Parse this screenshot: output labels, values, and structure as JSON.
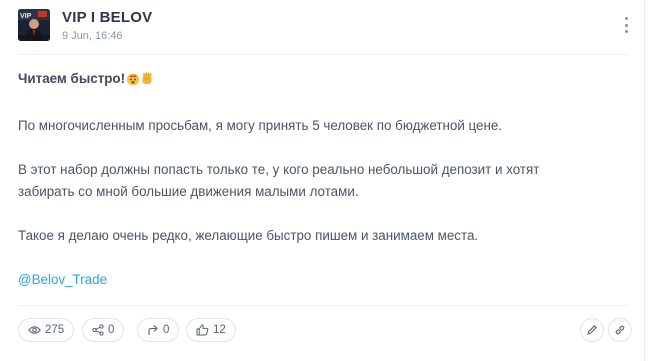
{
  "post": {
    "channel_name": "VIP I BELOV",
    "date": "9 Jun, 16:46",
    "headline": "Читаем быстро!",
    "paragraphs": [
      "По многочисленным просьбам, я могу принять 5 человек по бюджетной цене.",
      "В этот набор должны попасть только те, у кого реально небольшой депозит и хотят забирать со мной большие движения малыми лотами.",
      "Такое я делаю очень редко, желающие быстро пишем и занимаем места."
    ],
    "mention": "@Belov_Trade",
    "emojis": [
      "fire-face-emoji",
      "fist-emoji"
    ]
  },
  "stats": {
    "views": "275",
    "shares": "0",
    "forwards": "0",
    "reactions": "12"
  },
  "colors": {
    "link": "#2aa7d6",
    "text": "#4a5568",
    "title": "#2d3748",
    "muted": "#8a94a6",
    "border": "#dfe3e8"
  }
}
